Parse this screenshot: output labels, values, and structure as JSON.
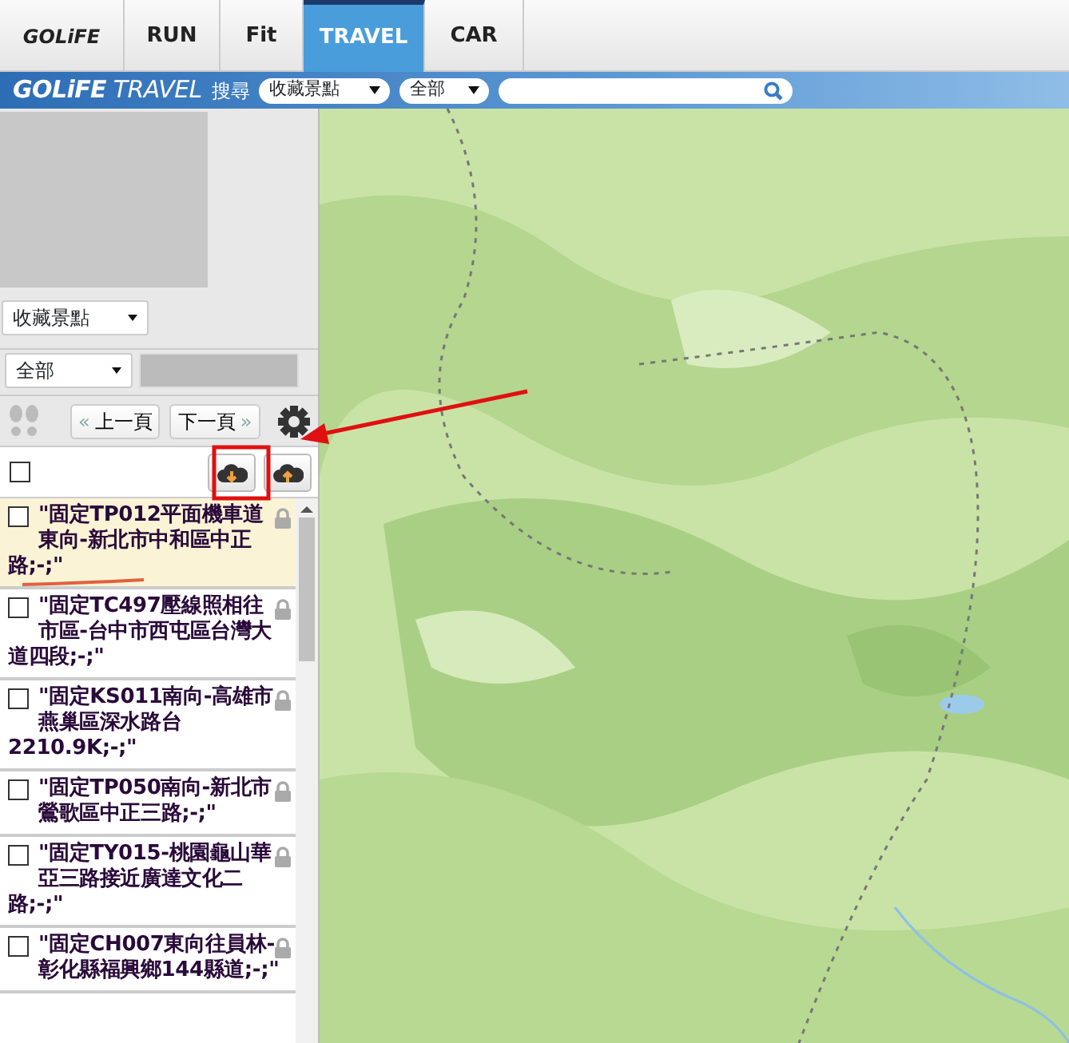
{
  "tabs": [
    {
      "label": "GOLiFE",
      "kind": "logo",
      "selected": false
    },
    {
      "label": "RUN",
      "kind": "tab",
      "selected": false
    },
    {
      "label": "Fit",
      "kind": "tab",
      "selected": false
    },
    {
      "label": "TRAVEL",
      "kind": "tab",
      "selected": true
    },
    {
      "label": "CAR",
      "kind": "tab",
      "selected": false
    }
  ],
  "toolbar": {
    "brand": "**GOLiFE** TRAVEL",
    "search_label": "搜尋",
    "category_select": "收藏景點",
    "region_select": "全部"
  },
  "sidebar": {
    "category_select": "收藏景點",
    "filter_select": "全部",
    "prev_button": {
      "icon": "«",
      "label": "上一頁"
    },
    "next_button": {
      "label": "下一頁",
      "icon": "»"
    },
    "select_all": {
      "checked": false
    },
    "items": [
      {
        "text": "\"固定TP012平面機車道東向-新北市中和區中正路;-;\"",
        "checked": false,
        "selected": true,
        "locked": true
      },
      {
        "text": "\"固定TC497壓線照相往市區-台中市西屯區台灣大道四段;-;\"",
        "checked": false,
        "selected": false,
        "locked": true
      },
      {
        "text": "\"固定KS011南向-高雄市燕巢區深水路台2210.9K;-;\"",
        "checked": false,
        "selected": false,
        "locked": true
      },
      {
        "text": "\"固定TP050南向-新北市鶯歌區中正三路;-;\"",
        "checked": false,
        "selected": false,
        "locked": true
      },
      {
        "text": "\"固定TY015-桃園龜山華亞三路接近廣達文化二路;-;\"",
        "checked": false,
        "selected": false,
        "locked": true
      },
      {
        "text": "\"固定CH007東向往員林-彰化縣福興鄉144縣道;-;\"",
        "checked": false,
        "selected": false,
        "locked": true
      }
    ]
  },
  "annotations": [
    {
      "kind": "box"
    },
    {
      "kind": "arrow"
    },
    {
      "kind": "underline"
    }
  ]
}
